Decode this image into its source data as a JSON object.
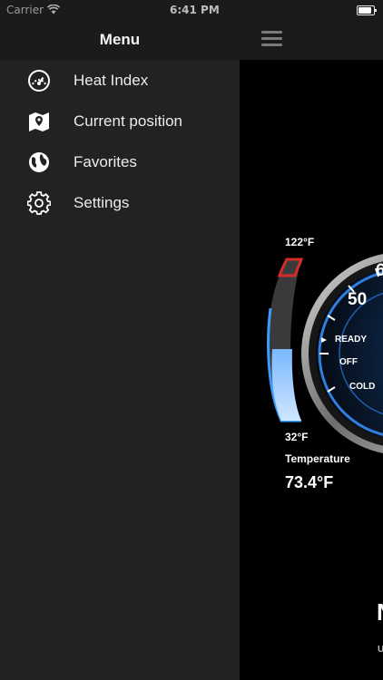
{
  "status_bar": {
    "carrier": "Carrier",
    "time": "6:41 PM"
  },
  "drawer": {
    "title": "Menu",
    "items": [
      {
        "label": "Heat Index",
        "icon": "speedometer-icon"
      },
      {
        "label": "Current position",
        "icon": "map-pin-icon"
      },
      {
        "label": "Favorites",
        "icon": "globe-icon"
      },
      {
        "label": "Settings",
        "icon": "gear-icon"
      }
    ]
  },
  "main": {
    "temp_max": "122°F",
    "temp_min": "32°F",
    "temperature_label": "Temperature",
    "temperature_value": "73.4°F",
    "temperature_level": 0.46,
    "gauge_numbers": [
      "50",
      "6"
    ],
    "gauge_states": [
      "READY",
      "OFF",
      "COLD"
    ],
    "edge_text_large": "N",
    "edge_text_small": "U"
  },
  "colors": {
    "drawer_bg": "#222222",
    "accent_blue": "#3d9cff",
    "warning_red": "#d62b2b"
  }
}
